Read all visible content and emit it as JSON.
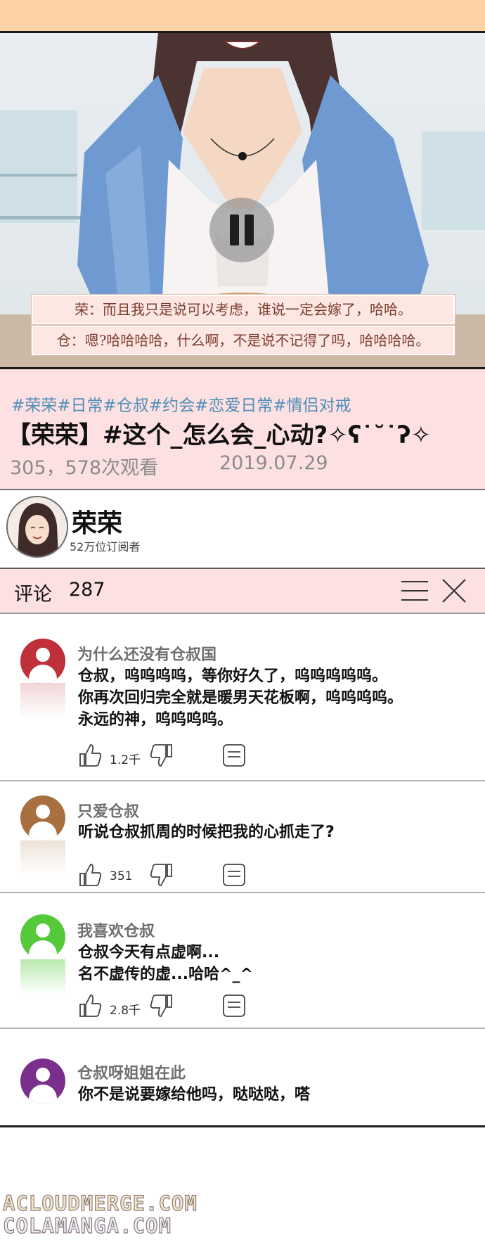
{
  "video": {
    "subtitle_1": "荣：而且我只是说可以考虑，谁说一定会嫁了，哈哈。",
    "subtitle_2": "仓：嗯?哈哈哈哈，什么啊，不是说不记得了吗，哈哈哈哈。"
  },
  "info": {
    "tags": "#荣荣#日常#仓叔#约会#恋爱日常#情侣对戒",
    "title": "【荣荣】#这个_怎么会_心动?✧ʕ˙˘˙ʔ✧",
    "views": "305，578次观看",
    "date": "2019.07.29"
  },
  "channel": {
    "name": "荣荣",
    "subscribers": "52万位订阅者"
  },
  "comments_header": {
    "label": "评论",
    "count": "287"
  },
  "comments": [
    {
      "user": "为什么还没有仓叔国",
      "text": "仓叔，呜呜呜呜，等你好久了，呜呜呜呜呜。\n你再次回归完全就是暖男天花板啊，呜呜呜呜。\n永远的神，呜呜呜呜。",
      "likes": "1.2千",
      "avatar_color": "#c0303a"
    },
    {
      "user": "只爱仓叔",
      "text": "听说仓叔抓周的时候把我的心抓走了?",
      "likes": "351",
      "avatar_color": "#a8703f"
    },
    {
      "user": "我喜欢仓叔",
      "text": "仓叔今天有点虚啊...\n名不虚传的虚...哈哈^_^",
      "likes": "2.8千",
      "avatar_color": "#56c93a"
    },
    {
      "user": "仓叔呀姐姐在此",
      "text": "你不是说要嫁给他吗，哒哒哒，嗒",
      "likes": "",
      "avatar_color": "#7b2f8c"
    }
  ],
  "watermark": {
    "line1": "ACLOUDMERGE.COM",
    "line2": "COLAMANGA.COM"
  }
}
